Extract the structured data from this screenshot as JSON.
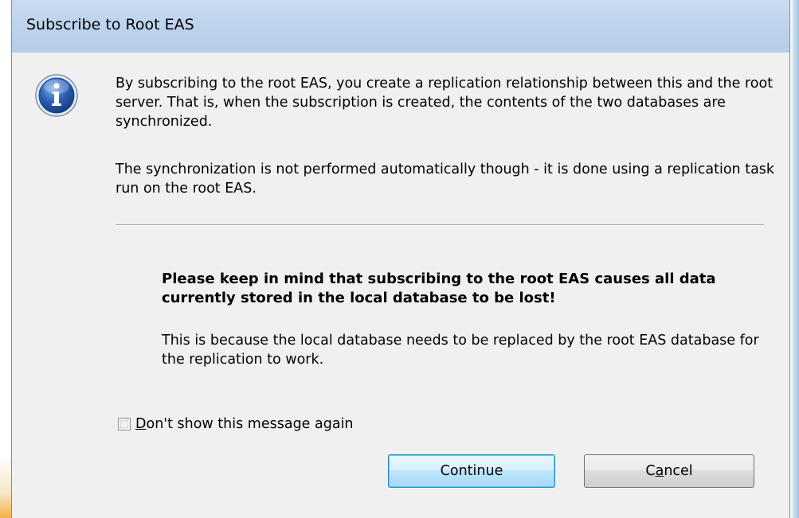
{
  "window": {
    "title": "Subscribe to Root EAS"
  },
  "icon": {
    "name": "info-icon",
    "color": "#2b5fb4"
  },
  "message": {
    "paragraph1": "By subscribing to the root EAS, you create a replication relationship between this and the root server. That is, when the subscription is created, the contents of the two databases are synchronized.",
    "paragraph2": "The synchronization is not performed automatically though - it is done using a replication task run on the root EAS.",
    "warning_title": "Please keep in mind that subscribing to the root EAS causes all data currently stored in the local database to be lost!",
    "warning_body": "This is because the local database needs to be replaced by the root EAS database for the replication to work."
  },
  "checkbox": {
    "label_mnemonic": "D",
    "label_rest": "on't show this message again",
    "checked": false
  },
  "buttons": {
    "continue_label": "Continue",
    "cancel_prefix": "C",
    "cancel_mnemonic": "a",
    "cancel_suffix": "ncel"
  },
  "colors": {
    "titlebar": "#bdd3ec",
    "dialog_bg": "#f0f0f0",
    "default_button_border": "#3c7fb1"
  }
}
